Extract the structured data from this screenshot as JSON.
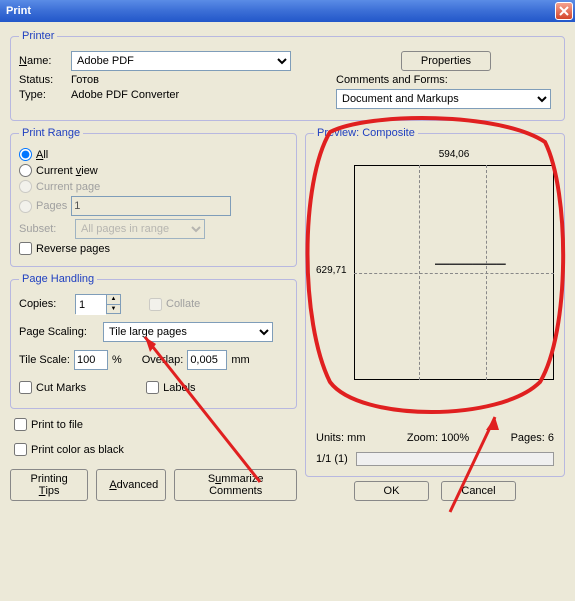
{
  "title": "Print",
  "printer": {
    "legend": "Printer",
    "name_label": "Name:",
    "name_value": "Adobe PDF",
    "properties_btn": "Properties",
    "status_label": "Status:",
    "status_value": "Готов",
    "type_label": "Type:",
    "type_value": "Adobe PDF Converter",
    "comments_label": "Comments and Forms:",
    "comments_value": "Document and Markups"
  },
  "range": {
    "legend": "Print Range",
    "all": "All",
    "current_view": "Current view",
    "current_page": "Current page",
    "pages": "Pages",
    "pages_value": "1",
    "subset_label": "Subset:",
    "subset_value": "All pages in range",
    "reverse": "Reverse pages"
  },
  "handling": {
    "legend": "Page Handling",
    "copies_label": "Copies:",
    "copies_value": "1",
    "collate_label": "Collate",
    "scaling_label": "Page Scaling:",
    "scaling_value": "Tile large pages",
    "tile_scale_label": "Tile Scale:",
    "tile_scale_value": "100",
    "percent": "%",
    "overlap_label": "Overlap:",
    "overlap_value": "0,005",
    "mm": "mm",
    "cut_marks": "Cut Marks",
    "labels": "Labels"
  },
  "print_to_file": "Print to file",
  "print_color_black": "Print color as black",
  "preview": {
    "legend": "Preview: Composite",
    "width": "594,06",
    "height": "629,71",
    "units": "Units: mm",
    "zoom": "Zoom: 100%",
    "pages": "Pages: 6",
    "page_indicator": "1/1 (1)"
  },
  "buttons": {
    "tips": "Printing Tips",
    "advanced": "Advanced",
    "summarize": "Summarize Comments",
    "ok": "OK",
    "cancel": "Cancel"
  }
}
